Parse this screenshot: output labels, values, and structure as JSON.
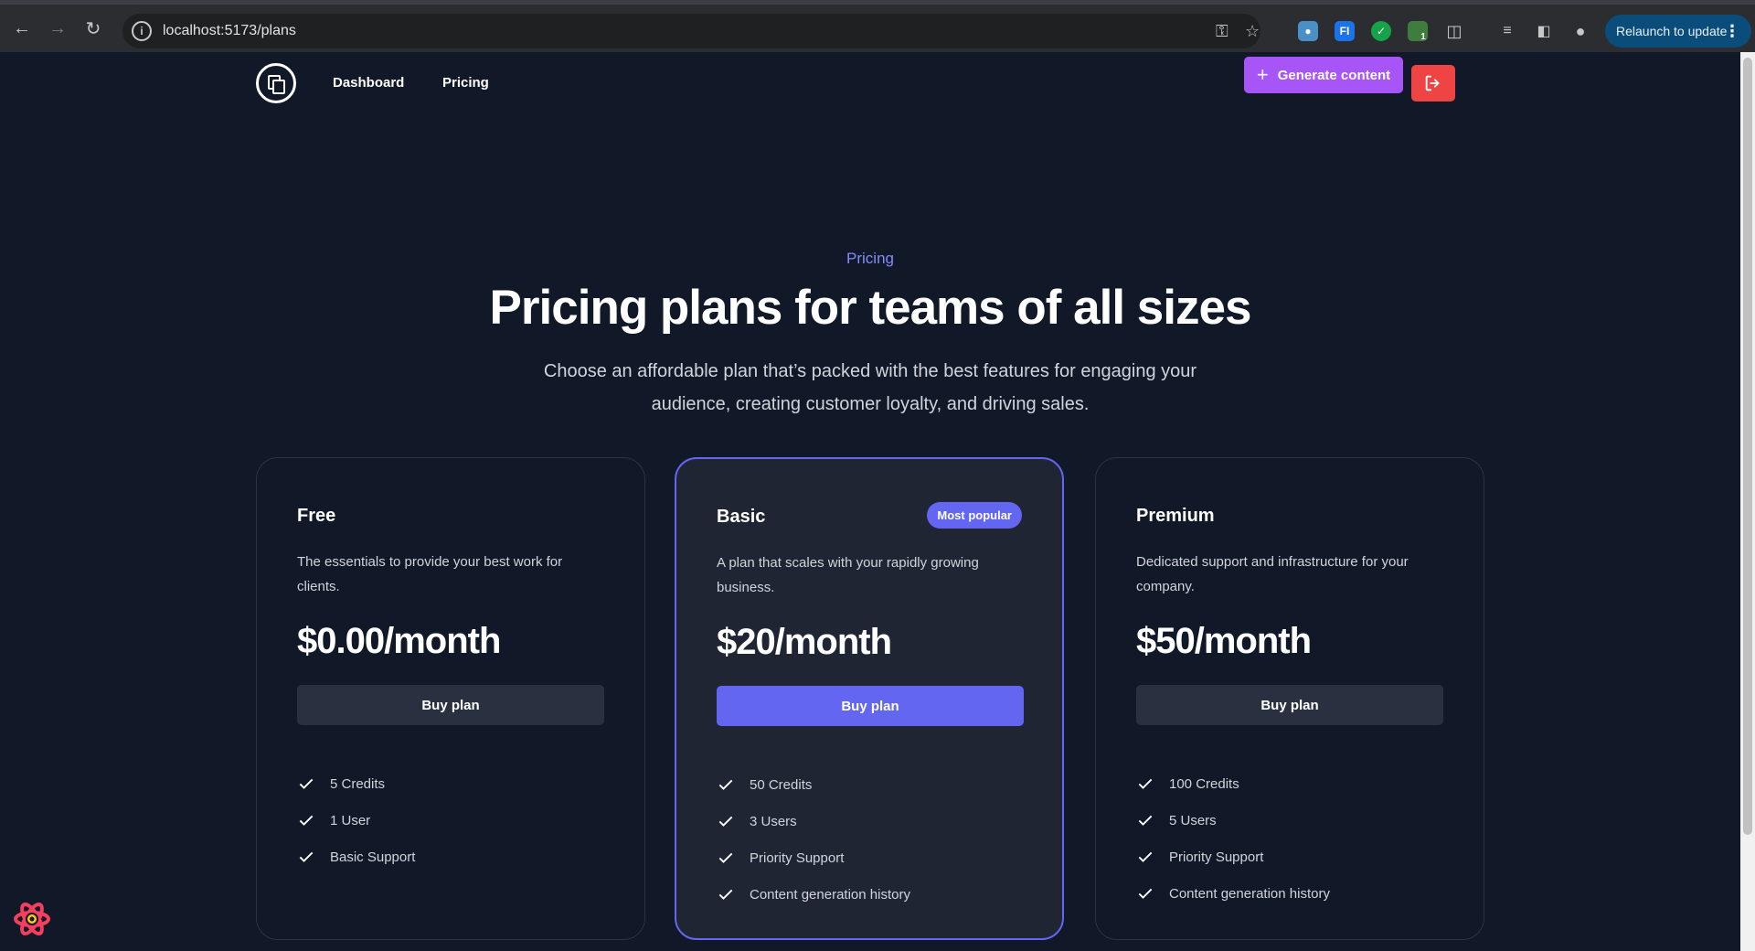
{
  "browser": {
    "url": "localhost:5173/plans",
    "relaunch_label": "Relaunch to update",
    "extension_badge": "1",
    "ext_fi_label": "FI"
  },
  "nav": {
    "links": [
      "Dashboard",
      "Pricing"
    ],
    "generate_label": "Generate content"
  },
  "hero": {
    "eyebrow": "Pricing",
    "title": "Pricing plans for teams of all sizes",
    "subtitle_line1": "Choose an affordable plan that’s packed with the best features for engaging your",
    "subtitle_line2": "audience, creating customer loyalty, and driving sales."
  },
  "plans": [
    {
      "name": "Free",
      "desc_line1": "The essentials to provide your best work for",
      "desc_line2": "clients.",
      "price": "$0.00/month",
      "button": "Buy plan",
      "features": [
        "5 Credits",
        "1 User",
        "Basic Support"
      ]
    },
    {
      "name": "Basic",
      "badge": "Most popular",
      "desc_line1": "A plan that scales with your rapidly growing",
      "desc_line2": "business.",
      "price": "$20/month",
      "button": "Buy plan",
      "features": [
        "50 Credits",
        "3 Users",
        "Priority Support",
        "Content generation history"
      ]
    },
    {
      "name": "Premium",
      "desc_line1": "Dedicated support and infrastructure for your",
      "desc_line2": "company.",
      "price": "$50/month",
      "button": "Buy plan",
      "features": [
        "100 Credits",
        "5 Users",
        "Priority Support",
        "Content generation history"
      ]
    }
  ],
  "colors": {
    "background": "#111827",
    "accent": "#6366f1",
    "generate": "#a855f7",
    "logout": "#ef4444"
  }
}
